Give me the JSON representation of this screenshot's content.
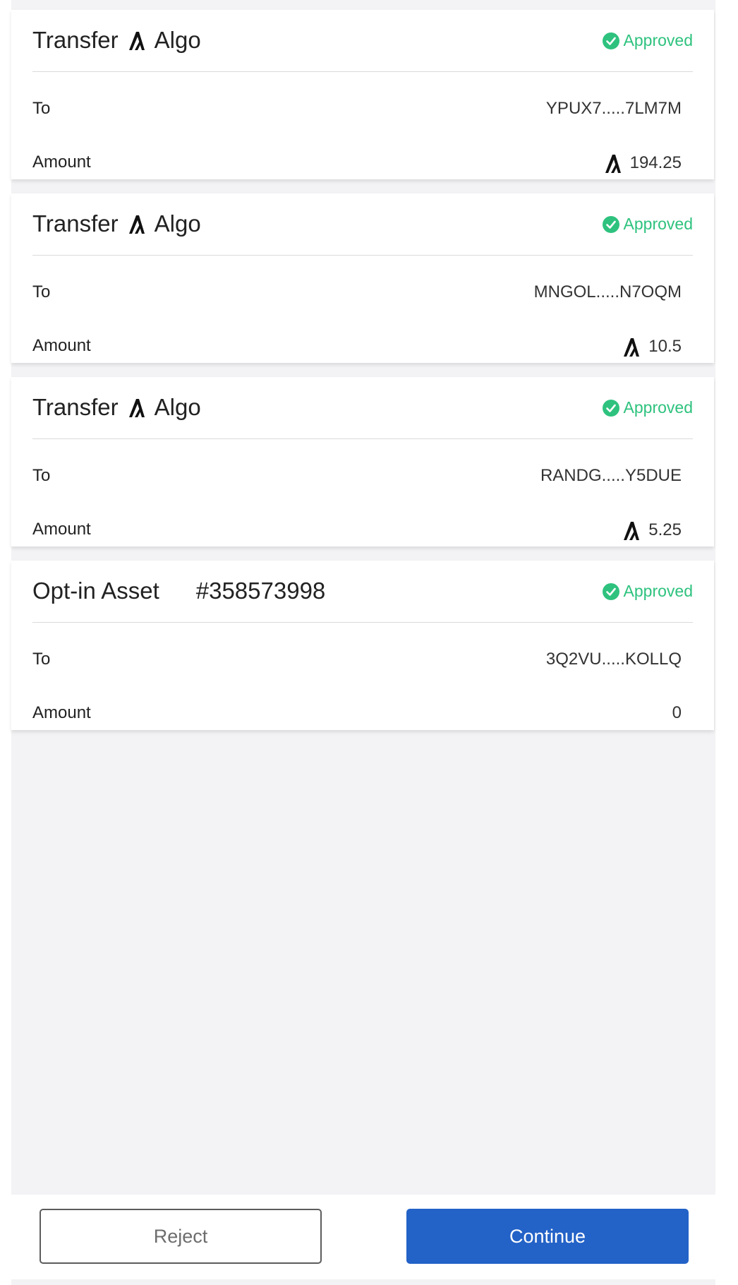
{
  "transactions": [
    {
      "type": "Transfer",
      "asset": "Algo",
      "status": "Approved",
      "to_label": "To",
      "to_value": "YPUX7.....7LM7M",
      "amount_label": "Amount",
      "amount_value": "194.25"
    },
    {
      "type": "Transfer",
      "asset": "Algo",
      "status": "Approved",
      "to_label": "To",
      "to_value": "MNGOL.....N7OQM",
      "amount_label": "Amount",
      "amount_value": "10.5"
    },
    {
      "type": "Transfer",
      "asset": "Algo",
      "status": "Approved",
      "to_label": "To",
      "to_value": "RANDG.....Y5DUE",
      "amount_label": "Amount",
      "amount_value": "5.25"
    },
    {
      "type": "Opt-in Asset",
      "asset": "#358573998",
      "status": "Approved",
      "to_label": "To",
      "to_value": "3Q2VU.....KOLLQ",
      "amount_label": "Amount",
      "amount_value": "0"
    }
  ],
  "buttons": {
    "reject": "Reject",
    "continue": "Continue"
  },
  "colors": {
    "approved": "#2ec27e",
    "primary": "#2362c7",
    "panel_bg": "#f3f3f5"
  },
  "icons": {
    "asset": "algorand-logo-icon",
    "status": "check-circle-icon"
  }
}
